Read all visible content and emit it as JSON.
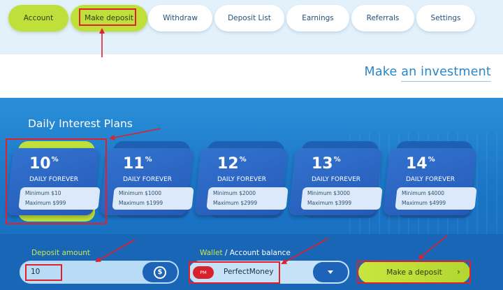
{
  "nav": {
    "tabs": [
      {
        "label": "Account"
      },
      {
        "label": "Make deposit"
      },
      {
        "label": "Withdraw"
      },
      {
        "label": "Deposit List"
      },
      {
        "label": "Earnings"
      },
      {
        "label": "Referrals"
      },
      {
        "label": "Settings"
      }
    ]
  },
  "heading": {
    "lead": "Make ",
    "emph": "an investment"
  },
  "plans": {
    "title": "Daily Interest Plans",
    "items": [
      {
        "percent": "10",
        "suffix": "%",
        "label": "DAILY FOREVER",
        "min": "Minimum $10",
        "max": "Maximum $999"
      },
      {
        "percent": "11",
        "suffix": "%",
        "label": "DAILY FOREVER",
        "min": "Minimum $1000",
        "max": "Maximum $1999"
      },
      {
        "percent": "12",
        "suffix": "%",
        "label": "DAILY FOREVER",
        "min": "Minimum $2000",
        "max": "Maximum $2999"
      },
      {
        "percent": "13",
        "suffix": "%",
        "label": "DAILY FOREVER",
        "min": "Minimum $3000",
        "max": "Maximum $3999"
      },
      {
        "percent": "14",
        "suffix": "%",
        "label": "DAILY FOREVER",
        "min": "Minimum $4000",
        "max": "Maximum $4999"
      }
    ]
  },
  "form": {
    "amount_label": "Deposit amount",
    "amount_value": "10",
    "coin_icon": "$",
    "wallet_label_a": "Wallet",
    "wallet_label_b": " / Account balance",
    "wallet_badge": "PM",
    "wallet_value": "PerfectMoney",
    "submit_label": "Make a deposit",
    "submit_chevron": "›"
  },
  "colors": {
    "accent_green": "#bfe03a",
    "brand_blue": "#1d64b8",
    "annotation_red": "#e0202a"
  }
}
